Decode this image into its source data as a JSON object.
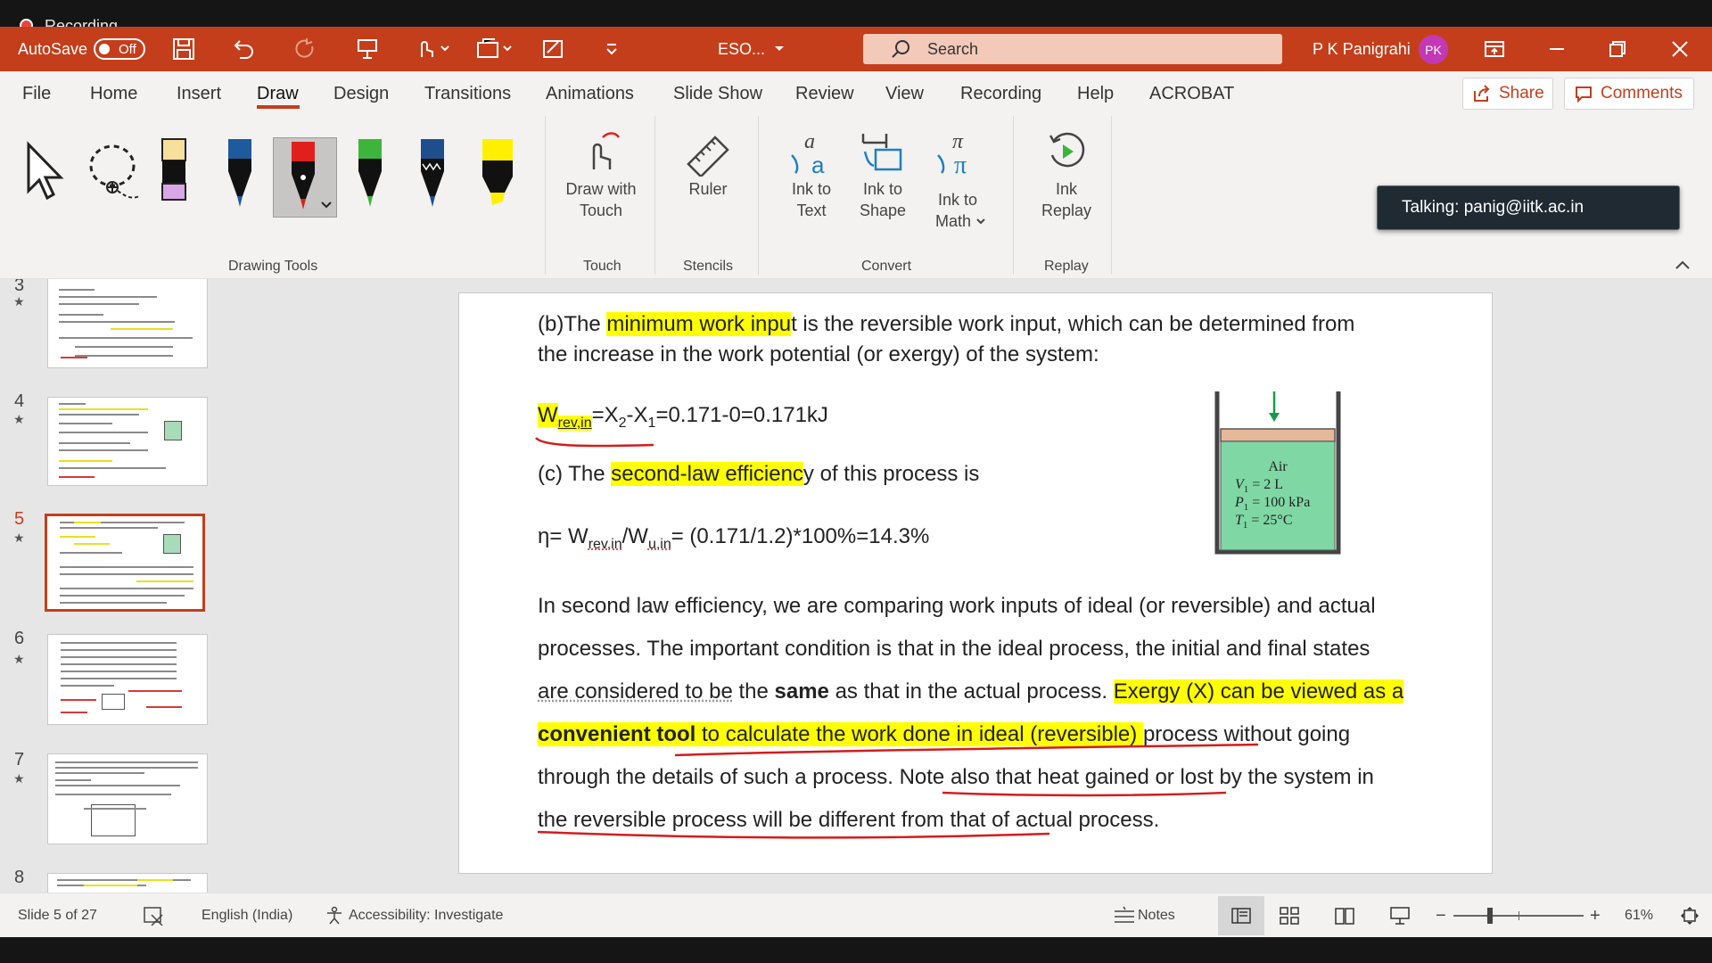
{
  "recording": {
    "label": "Recording"
  },
  "titlebar": {
    "autosave_label": "AutoSave",
    "autosave_state": "Off",
    "document_title": "ESO...",
    "search_placeholder": "Search",
    "user_name": "P K Panigrahi",
    "user_initials": "PK",
    "accent_color": "#c43e1c"
  },
  "menu": {
    "tabs": [
      "File",
      "Home",
      "Insert",
      "Draw",
      "Design",
      "Transitions",
      "Animations",
      "Slide Show",
      "Review",
      "View",
      "Recording",
      "Help",
      "ACROBAT"
    ],
    "active_tab": "Draw",
    "share_label": "Share",
    "comments_label": "Comments"
  },
  "ribbon": {
    "groups": {
      "drawing_tools": "Drawing Tools",
      "touch": "Touch",
      "stencils": "Stencils",
      "convert": "Convert",
      "replay": "Replay"
    },
    "buttons": {
      "draw_with_touch": [
        "Draw with",
        "Touch"
      ],
      "ruler": "Ruler",
      "ink_to_text": [
        "Ink to",
        "Text"
      ],
      "ink_to_shape": [
        "Ink to",
        "Shape"
      ],
      "ink_to_math": [
        "Ink to",
        "Math"
      ],
      "ink_replay": [
        "Ink",
        "Replay"
      ]
    },
    "pens": [
      {
        "name": "highlighter-pink",
        "color": "#d9a6e8"
      },
      {
        "name": "pen-blue",
        "color": "#1e5a9c"
      },
      {
        "name": "pen-red",
        "color": "#e0201b"
      },
      {
        "name": "pen-green",
        "color": "#3db53b"
      },
      {
        "name": "pen-navy",
        "color": "#1e4f8c"
      },
      {
        "name": "highlighter-yellow",
        "color": "#fff000"
      }
    ]
  },
  "tooltip": {
    "talking": "Talking: panig@iitk.ac.in"
  },
  "thumbnails": {
    "numbers": [
      "3",
      "4",
      "5",
      "6",
      "7",
      "8"
    ],
    "selected": "5"
  },
  "slide": {
    "line1a": "(b)The ",
    "line1_hl": "minimum work inpu",
    "line1b": "t is the reversible work input, which can be determined from",
    "line2": "the increase in the work potential (or exergy) of the system:",
    "eq1_w": "W",
    "eq1_sub": "rev,in",
    "eq1_rest_a": "=X",
    "eq1_sub2": "2",
    "eq1_rest_b": "-X",
    "eq1_sub1": "1",
    "eq1_rest_c": "=0.171-0=0.171kJ",
    "line_c_a": "(c) The ",
    "line_c_hl": "second-law efficienc",
    "line_c_b": "y of this process is",
    "eta_a": "η= W",
    "eta_sub1": "rev,in",
    "eta_b": "/W",
    "eta_sub2": "u,in",
    "eta_c": "= (0.171/1.2)*100%=14.3%",
    "p1": "In second law efficiency, we are comparing work inputs of ideal (or reversible) and actual",
    "p2": "processes.   The important condition is that in the ideal process, the initial and final states",
    "p3a": "are considered to be",
    "p3b": " the ",
    "p3_bold": "same",
    "p3c": " as that in the actual process.   ",
    "p3_hl": "Exergy (X) can be viewed as a",
    "p4_bold_hl": "convenient tool",
    "p4_hl": " to calculate the work done in ideal (reversible) ",
    "p4b": "process without going",
    "p5a": "through the details of such  a process.  Note also that ",
    "p5_ul": "heat gained or lost by the system ",
    "p5b": "in",
    "p6a": "the reversible process will be ",
    "p6_ul": "different",
    "p6b": " from that of actual process.",
    "figure": {
      "title": "Air",
      "v": "V",
      "v_sub": "1",
      "v_val": " = 2 L",
      "p": "P",
      "p_sub": "1",
      "p_val": " = 100 kPa",
      "t": "T",
      "t_sub": "1",
      "t_val": " = 25°C"
    }
  },
  "status": {
    "slide_info": "Slide 5 of 27",
    "language": "English (India)",
    "accessibility": "Accessibility: Investigate",
    "notes": "Notes",
    "zoom": "61%",
    "zoom_level": 0.61
  }
}
